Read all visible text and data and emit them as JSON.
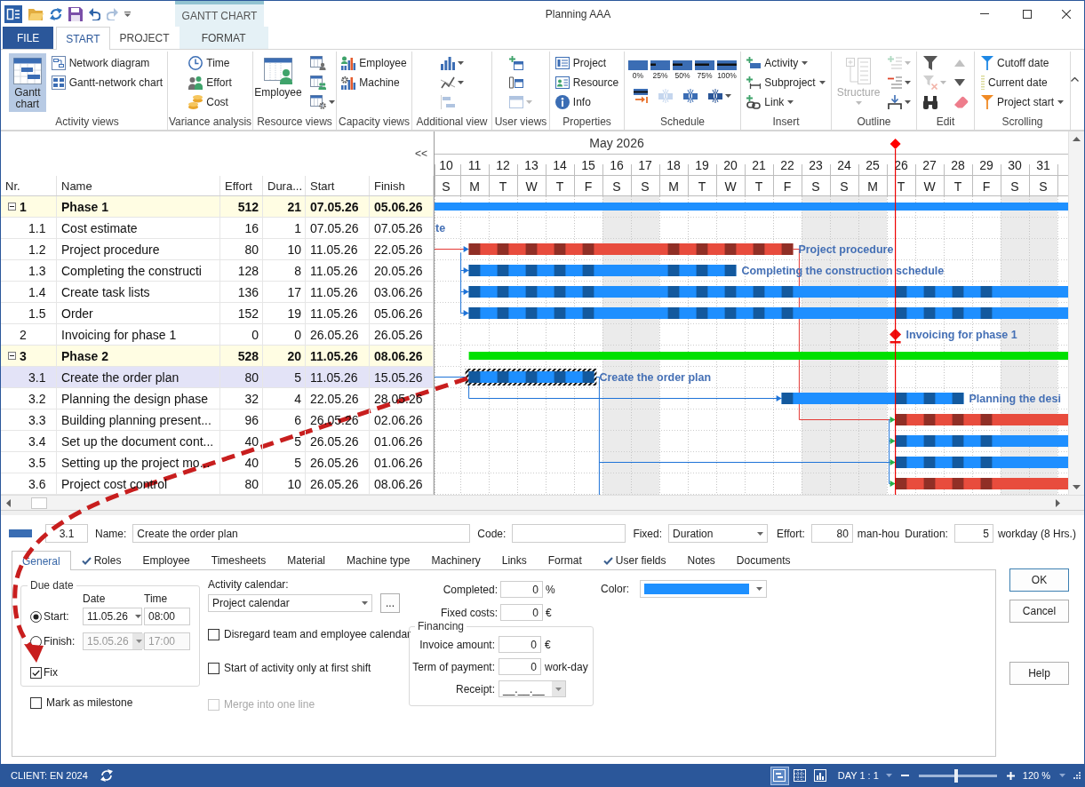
{
  "window": {
    "title": "Planning AAA",
    "context_tab_group": "GANTT CHART"
  },
  "quick_access": [
    {
      "disabled": false
    },
    {
      "disabled": false
    },
    {
      "disabled": false
    },
    {
      "disabled": false
    },
    {
      "disabled": true
    }
  ],
  "ribbon_tabs": [
    {
      "label": "FILE",
      "kind": "file",
      "selected": false
    },
    {
      "label": "START",
      "kind": "tab",
      "selected": true
    },
    {
      "label": "PROJECT",
      "kind": "tab",
      "selected": false
    },
    {
      "label": "FORMAT",
      "kind": "context",
      "selected": false
    }
  ],
  "ribbon_groups": [
    {
      "label": "Activity views",
      "items": [
        {
          "kind": "large",
          "label": "Gantt chart",
          "selected": true,
          "disabled": false,
          "dropdown": false
        },
        {
          "kind": "small",
          "label": "Network diagram",
          "selected": false,
          "disabled": false,
          "dropdown": false
        },
        {
          "kind": "small",
          "label": "Gantt-network chart",
          "selected": false,
          "disabled": false,
          "dropdown": false
        }
      ]
    },
    {
      "label": "Variance analysis",
      "items": [
        {
          "kind": "small",
          "label": "Time",
          "disabled": false,
          "dropdown": false
        },
        {
          "kind": "small",
          "label": "Effort",
          "disabled": false,
          "dropdown": false
        },
        {
          "kind": "small",
          "label": "Cost",
          "disabled": false,
          "dropdown": false
        }
      ]
    },
    {
      "label": "Resource views",
      "items": [
        {
          "kind": "large",
          "label": "Employee",
          "disabled": false,
          "dropdown": false
        },
        {
          "kind": "tile",
          "disabled": false,
          "dropdown": false
        },
        {
          "kind": "tile",
          "disabled": false,
          "dropdown": false
        },
        {
          "kind": "tile",
          "disabled": false,
          "dropdown": true
        }
      ]
    },
    {
      "label": "Capacity views",
      "items": [
        {
          "kind": "small",
          "label": "Employee",
          "disabled": false,
          "dropdown": false
        },
        {
          "kind": "small",
          "label": "Machine",
          "disabled": false,
          "dropdown": false
        }
      ]
    },
    {
      "label": "Additional view",
      "items": [
        {
          "kind": "tile",
          "disabled": false,
          "dropdown": true
        },
        {
          "kind": "tile",
          "disabled": false,
          "dropdown": true
        },
        {
          "kind": "tile",
          "disabled": true,
          "dropdown": false
        }
      ]
    },
    {
      "label": "User views",
      "items": [
        {
          "kind": "tile",
          "disabled": false,
          "dropdown": false
        },
        {
          "kind": "tile",
          "disabled": false,
          "dropdown": false
        },
        {
          "kind": "tile",
          "disabled": true,
          "dropdown": true
        }
      ]
    },
    {
      "label": "Properties",
      "items": [
        {
          "kind": "small",
          "label": "Project",
          "disabled": false,
          "dropdown": false
        },
        {
          "kind": "small",
          "label": "Resource",
          "disabled": false,
          "dropdown": false
        },
        {
          "kind": "small",
          "label": "Info",
          "disabled": false,
          "dropdown": false
        }
      ]
    },
    {
      "label": "Schedule",
      "items": [
        {
          "kind": "progress",
          "label": "0%",
          "disabled": false,
          "dropdown": false
        },
        {
          "kind": "progress",
          "label": "25%",
          "disabled": false,
          "dropdown": false
        },
        {
          "kind": "progress",
          "label": "50%",
          "disabled": false,
          "dropdown": false
        },
        {
          "kind": "progress",
          "label": "75%",
          "disabled": false,
          "dropdown": false
        },
        {
          "kind": "progress",
          "label": "100%",
          "disabled": false,
          "dropdown": false
        },
        {
          "kind": "tile",
          "disabled": false,
          "dropdown": false
        },
        {
          "kind": "tile",
          "disabled": true,
          "dropdown": false
        },
        {
          "kind": "tile",
          "disabled": false,
          "dropdown": false
        },
        {
          "kind": "tile",
          "disabled": false,
          "dropdown": true
        }
      ]
    },
    {
      "label": "Insert",
      "items": [
        {
          "kind": "small",
          "label": "Activity",
          "disabled": false,
          "dropdown": true
        },
        {
          "kind": "small",
          "label": "Subproject",
          "disabled": false,
          "dropdown": true
        },
        {
          "kind": "small",
          "label": "Link",
          "disabled": false,
          "dropdown": true
        }
      ]
    },
    {
      "label": "Outline",
      "items": [
        {
          "kind": "large",
          "label": "Structure",
          "disabled": true,
          "dropdown": true
        },
        {
          "kind": "tile",
          "disabled": true,
          "dropdown": true
        },
        {
          "kind": "tile",
          "disabled": false,
          "dropdown": true
        },
        {
          "kind": "tile",
          "disabled": false,
          "dropdown": true
        }
      ]
    },
    {
      "label": "Edit",
      "items": [
        {
          "kind": "tile",
          "disabled": false,
          "dropdown": false
        },
        {
          "kind": "tile",
          "disabled": true,
          "dropdown": true
        },
        {
          "kind": "tile",
          "disabled": false,
          "dropdown": false
        },
        {
          "kind": "tile",
          "disabled": true,
          "dropdown": false
        },
        {
          "kind": "tile",
          "disabled": false,
          "dropdown": false
        },
        {
          "kind": "tile",
          "disabled": false,
          "dropdown": false
        }
      ]
    },
    {
      "label": "Scrolling",
      "items": [
        {
          "kind": "small",
          "label": "Cutoff date",
          "disabled": false,
          "dropdown": false
        },
        {
          "kind": "small",
          "label": "Current date",
          "disabled": false,
          "dropdown": false
        },
        {
          "kind": "small",
          "label": "Project start",
          "disabled": false,
          "dropdown": true
        }
      ]
    }
  ],
  "table": {
    "collapse_button": "<<",
    "columns": [
      "Nr.",
      "Name",
      "Effort",
      "Dura...",
      "Start",
      "Finish"
    ],
    "rows": [
      {
        "nr": "1",
        "name": "Phase 1",
        "effort": "512",
        "duration": "21",
        "start": "07.05.26",
        "finish": "05.06.26",
        "expanded": true,
        "selected": false,
        "bar": {
          "kind": "summary",
          "color": "#1e90ff"
        },
        "children": [
          {
            "nr": "1.1",
            "name": "Cost estimate",
            "effort": "16",
            "duration": "1",
            "start": "07.05.26",
            "finish": "07.05.26",
            "selected": false,
            "bar": {
              "kind": "task",
              "label": "te"
            }
          },
          {
            "nr": "1.2",
            "name": "Project procedure",
            "effort": "80",
            "duration": "10",
            "start": "11.05.26",
            "finish": "22.05.26",
            "selected": false,
            "bar": {
              "kind": "task",
              "color": "#e84c3d",
              "label": "Project procedure"
            }
          },
          {
            "nr": "1.3",
            "name": "Completing the constructi",
            "effort": "128",
            "duration": "8",
            "start": "11.05.26",
            "finish": "20.05.26",
            "selected": false,
            "bar": {
              "kind": "task",
              "color": "#1e8fff",
              "label": "Completing the construction schedule"
            }
          },
          {
            "nr": "1.4",
            "name": "Create task lists",
            "effort": "136",
            "duration": "17",
            "start": "11.05.26",
            "finish": "03.06.26",
            "selected": false,
            "bar": {
              "kind": "task",
              "color": "#1e8fff"
            }
          },
          {
            "nr": "1.5",
            "name": "Order",
            "effort": "152",
            "duration": "19",
            "start": "11.05.26",
            "finish": "05.06.26",
            "selected": false,
            "bar": {
              "kind": "task",
              "color": "#1e8fff"
            }
          }
        ]
      },
      {
        "nr": "2",
        "name": "Invoicing for phase 1",
        "effort": "0",
        "duration": "0",
        "start": "26.05.26",
        "finish": "26.05.26",
        "selected": false,
        "bar": {
          "kind": "milestone",
          "color": "#f01010",
          "label": "Invoicing for phase 1"
        }
      },
      {
        "nr": "3",
        "name": "Phase 2",
        "effort": "528",
        "duration": "20",
        "start": "11.05.26",
        "finish": "08.06.26",
        "expanded": true,
        "selected": false,
        "bar": {
          "kind": "summary",
          "color": "#00e000"
        },
        "children": [
          {
            "nr": "3.1",
            "name": "Create the order plan",
            "effort": "80",
            "duration": "5",
            "start": "11.05.26",
            "finish": "15.05.26",
            "selected": true,
            "bar": {
              "kind": "task",
              "color": "#1e8fff",
              "label": "Create the order plan"
            }
          },
          {
            "nr": "3.2",
            "name": "Planning the design phase",
            "effort": "32",
            "duration": "4",
            "start": "22.05.26",
            "finish": "28.05.26",
            "selected": false,
            "bar": {
              "kind": "task",
              "color": "#1e8fff",
              "label": "Planning the desi"
            }
          },
          {
            "nr": "3.3",
            "name": "Building planning present...",
            "effort": "96",
            "duration": "6",
            "start": "26.05.26",
            "finish": "02.06.26",
            "selected": false,
            "bar": {
              "kind": "task",
              "color": "#e84c3d"
            }
          },
          {
            "nr": "3.4",
            "name": "Set up the document cont...",
            "effort": "40",
            "duration": "5",
            "start": "26.05.26",
            "finish": "01.06.26",
            "selected": false,
            "bar": {
              "kind": "task",
              "color": "#1e8fff"
            }
          },
          {
            "nr": "3.5",
            "name": "Setting up the project mo...",
            "effort": "40",
            "duration": "5",
            "start": "26.05.26",
            "finish": "01.06.26",
            "selected": false,
            "bar": {
              "kind": "task",
              "color": "#1e8fff"
            }
          },
          {
            "nr": "3.6",
            "name": "Project cost control",
            "effort": "80",
            "duration": "10",
            "start": "26.05.26",
            "finish": "08.06.26",
            "selected": false,
            "bar": {
              "kind": "task",
              "color": "#e84c3d"
            }
          }
        ]
      }
    ]
  },
  "gantt": {
    "month": "May 2026",
    "days": [
      {
        "day": "10",
        "weekday": "S",
        "non_working": false,
        "today": false
      },
      {
        "day": "11",
        "weekday": "M",
        "non_working": false,
        "today": false
      },
      {
        "day": "12",
        "weekday": "T",
        "non_working": false,
        "today": false
      },
      {
        "day": "13",
        "weekday": "W",
        "non_working": false,
        "today": false
      },
      {
        "day": "14",
        "weekday": "T",
        "non_working": false,
        "today": false
      },
      {
        "day": "15",
        "weekday": "F",
        "non_working": false,
        "today": false
      },
      {
        "day": "16",
        "weekday": "S",
        "non_working": true,
        "today": false
      },
      {
        "day": "17",
        "weekday": "S",
        "non_working": true,
        "today": false
      },
      {
        "day": "18",
        "weekday": "M",
        "non_working": false,
        "today": false
      },
      {
        "day": "19",
        "weekday": "T",
        "non_working": false,
        "today": false
      },
      {
        "day": "20",
        "weekday": "W",
        "non_working": false,
        "today": false
      },
      {
        "day": "21",
        "weekday": "T",
        "non_working": false,
        "today": false
      },
      {
        "day": "22",
        "weekday": "F",
        "non_working": false,
        "today": false
      },
      {
        "day": "23",
        "weekday": "S",
        "non_working": true,
        "today": false
      },
      {
        "day": "24",
        "weekday": "S",
        "non_working": true,
        "today": false
      },
      {
        "day": "25",
        "weekday": "M",
        "non_working": true,
        "today": false
      },
      {
        "day": "26",
        "weekday": "T",
        "non_working": false,
        "today": true
      },
      {
        "day": "27",
        "weekday": "W",
        "non_working": false,
        "today": false
      },
      {
        "day": "28",
        "weekday": "T",
        "non_working": false,
        "today": false
      },
      {
        "day": "29",
        "weekday": "F",
        "non_working": false,
        "today": false
      },
      {
        "day": "30",
        "weekday": "S",
        "non_working": true,
        "today": false
      },
      {
        "day": "31",
        "weekday": "S",
        "non_working": true,
        "today": false
      }
    ]
  },
  "detail": {
    "nr": "3.1",
    "name_label": "Name:",
    "name": "Create the order plan",
    "code_label": "Code:",
    "fixed_label": "Fixed:",
    "fixed": "Duration",
    "effort_label": "Effort:",
    "effort": "80",
    "effort_unit": "man-hou",
    "duration_label": "Duration:",
    "duration": "5",
    "duration_unit": "workday (8 Hrs.)",
    "tabs": [
      {
        "label": "General",
        "selected": true,
        "ticked": false
      },
      {
        "label": "Roles",
        "selected": false,
        "ticked": true
      },
      {
        "label": "Employee",
        "selected": false,
        "ticked": false
      },
      {
        "label": "Timesheets",
        "selected": false,
        "ticked": false
      },
      {
        "label": "Material",
        "selected": false,
        "ticked": false
      },
      {
        "label": "Machine type",
        "selected": false,
        "ticked": false
      },
      {
        "label": "Machinery",
        "selected": false,
        "ticked": false
      },
      {
        "label": "Links",
        "selected": false,
        "ticked": false
      },
      {
        "label": "Format",
        "selected": false,
        "ticked": false
      },
      {
        "label": "User fields",
        "selected": false,
        "ticked": true
      },
      {
        "label": "Notes",
        "selected": false,
        "ticked": false
      },
      {
        "label": "Documents",
        "selected": false,
        "ticked": false
      }
    ],
    "due_date": {
      "title": "Due date",
      "date_header": "Date",
      "time_header": "Time",
      "rows": [
        {
          "label": "Start:",
          "selected": true,
          "date": "11.05.26",
          "time": "08:00",
          "disabled": false
        },
        {
          "label": "Finish:",
          "selected": false,
          "date": "15.05.26",
          "time": "17:00",
          "disabled": true
        }
      ],
      "fix": {
        "label": "Fix",
        "checked": true
      }
    },
    "milestone": {
      "label": "Mark as milestone",
      "checked": false
    },
    "calendar": {
      "label": "Activity calendar:",
      "value": "Project calendar",
      "button": "..."
    },
    "options": [
      {
        "label": "Disregard team and employee calendar",
        "checked": false,
        "disabled": false
      },
      {
        "label": "Start of activity only at first shift",
        "checked": false,
        "disabled": false
      },
      {
        "label": "Merge into one line",
        "checked": false,
        "disabled": true
      }
    ],
    "amounts": [
      {
        "label": "Completed:",
        "value": "0",
        "unit": "%"
      },
      {
        "label": "Fixed costs:",
        "value": "0",
        "unit": "€"
      }
    ],
    "financing": {
      "title": "Financing",
      "fields": [
        {
          "kind": "number",
          "label": "Invoice amount:",
          "value": "0",
          "unit": "€"
        },
        {
          "kind": "number",
          "label": "Term of payment:",
          "value": "0",
          "unit": "work-day"
        },
        {
          "kind": "date",
          "label": "Receipt:",
          "value": "__.__.__"
        }
      ]
    },
    "color_label": "Color:",
    "buttons": [
      {
        "label": "OK",
        "kind": "default"
      },
      {
        "label": "Cancel",
        "kind": "cancel"
      },
      {
        "label": "Help",
        "kind": "help"
      }
    ]
  },
  "status_bar": {
    "client": "CLIENT: EN 2024",
    "views": [
      {
        "selected": true
      },
      {
        "selected": false
      },
      {
        "selected": false
      }
    ],
    "scale": "DAY 1 : 1",
    "zoom": {
      "level": 0.48,
      "label": "120 %"
    }
  }
}
